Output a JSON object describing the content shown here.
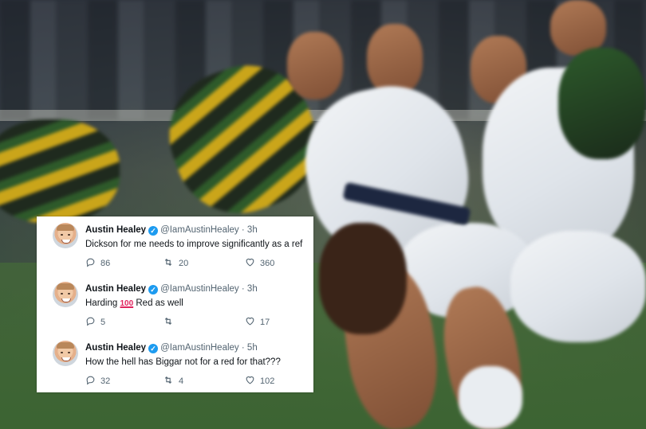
{
  "tweets": [
    {
      "name": "Austin Healey",
      "handle": "@IamAustinHealey",
      "time": "3h",
      "text": "Dickson for me needs to improve significantly as a ref",
      "replies": "86",
      "retweets": "20",
      "likes": "360"
    },
    {
      "name": "Austin Healey",
      "handle": "@IamAustinHealey",
      "time": "3h",
      "text_before": "Harding",
      "emoji": "100",
      "text_after": "Red as well",
      "replies": "5",
      "retweets": "",
      "likes": "17"
    },
    {
      "name": "Austin Healey",
      "handle": "@IamAustinHealey",
      "time": "5h",
      "text": "How the hell has Biggar not for a red for that???",
      "replies": "32",
      "retweets": "4",
      "likes": "102"
    }
  ],
  "separator": "·",
  "colors": {
    "verified": "#1d9bf0",
    "text": "#0f1419",
    "muted": "#536471",
    "emoji": "#e0245e"
  },
  "icons": [
    "reply-icon",
    "retweet-icon",
    "like-icon",
    "verified-badge-icon"
  ]
}
